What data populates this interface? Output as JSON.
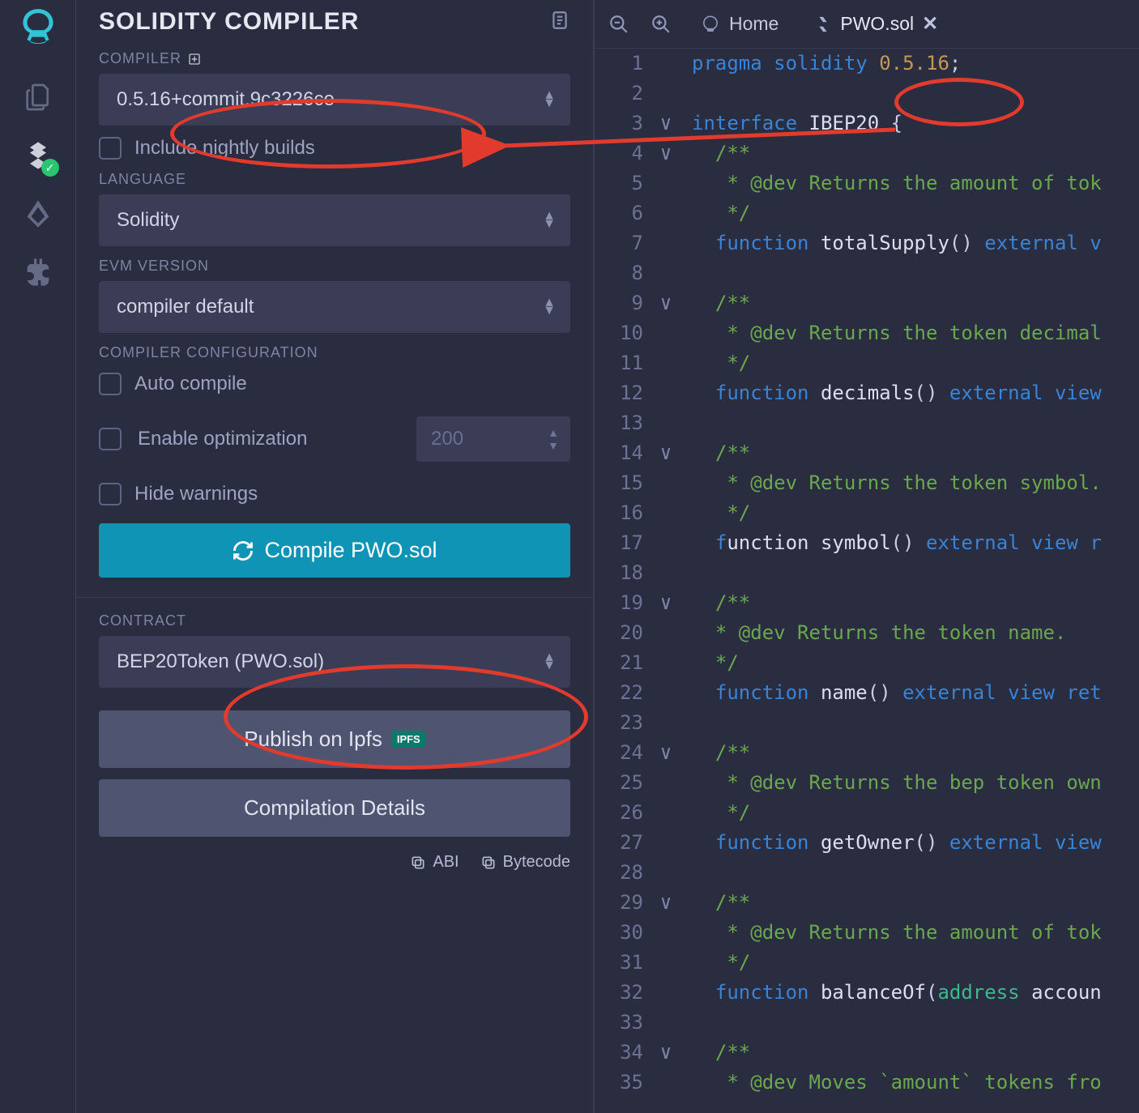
{
  "panel": {
    "title": "SOLIDITY COMPILER",
    "compiler_label": "COMPILER",
    "compiler_value": "0.5.16+commit.9c3226ce",
    "include_nightly": "Include nightly builds",
    "language_label": "LANGUAGE",
    "language_value": "Solidity",
    "evm_label": "EVM VERSION",
    "evm_value": "compiler default",
    "config_label": "COMPILER CONFIGURATION",
    "auto_compile": "Auto compile",
    "enable_opt": "Enable optimization",
    "opt_runs": "200",
    "hide_warnings": "Hide warnings",
    "compile_btn": "Compile PWO.sol",
    "contract_label": "CONTRACT",
    "contract_value": "BEP20Token (PWO.sol)",
    "publish_btn": "Publish on Ipfs",
    "details_btn": "Compilation Details",
    "abi": "ABI",
    "bytecode": "Bytecode"
  },
  "tabs": {
    "home": "Home",
    "file": "PWO.sol"
  },
  "code": {
    "line1_a": "pragma",
    "line1_b": "solidity",
    "line1_c": "0.5.16",
    "line1_d": ";",
    "line3_a": "interface",
    "line3_b": "IBEP20",
    "line3_c": "{",
    "doc_open": "/**",
    "doc_close": " */",
    "doc_tok_amount": " * @dev Returns the amount of tok",
    "doc_decimals": " * @dev Returns the token decimal",
    "doc_symbol": " * @dev Returns the token symbol.",
    "doc_name": "* @dev Returns the token name.",
    "doc_owner": " * @dev Returns the bep token own",
    "doc_amount2": " * @dev Returns the amount of tok",
    "doc_moves": " * @dev Moves `amount` tokens fro",
    "fn_kw": "function",
    "ext_kw": "external",
    "view_kw": "view",
    "ret_kw": "ret",
    "addr_kw": "address",
    "totalSupply": "totalSupply",
    "decimals": "decimals",
    "symbol": "symbol",
    "name": "name",
    "getOwner": "getOwner",
    "balanceOf": "balanceOf",
    "accoun": "accoun",
    "v_tail": "v",
    "r_tail": "r",
    "view_tail": "view",
    "external_tail_v": "view"
  }
}
